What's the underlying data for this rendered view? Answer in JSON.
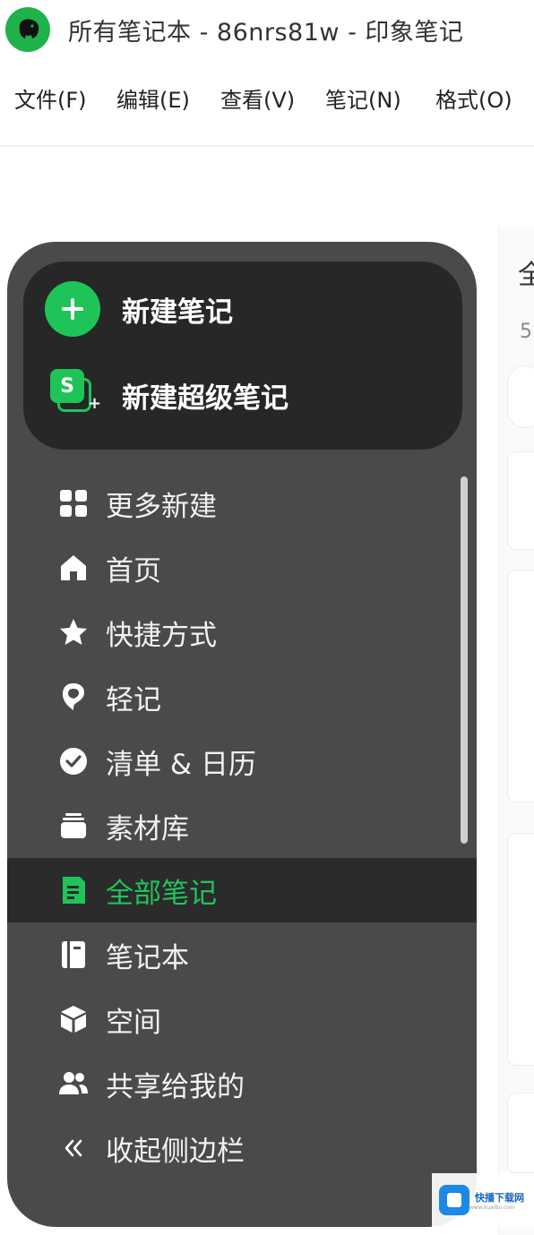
{
  "window": {
    "title": "所有笔记本 - 86nrs81w - 印象笔记",
    "app_icon": "elephant-icon",
    "accent_color": "#1fc459"
  },
  "menu": {
    "items": [
      "文件(F)",
      "编辑(E)",
      "查看(V)",
      "笔记(N)",
      "格式(O)"
    ]
  },
  "sidebar": {
    "create": {
      "new_note": "新建笔记",
      "new_super_note": "新建超级笔记",
      "super_icon_letter": "S"
    },
    "items": [
      {
        "label": "更多新建",
        "icon": "grid-icon",
        "active": false
      },
      {
        "label": "首页",
        "icon": "home-icon",
        "active": false
      },
      {
        "label": "快捷方式",
        "icon": "star-icon",
        "active": false
      },
      {
        "label": "轻记",
        "icon": "quick-note-icon",
        "active": false
      },
      {
        "label": "清单 & 日历",
        "icon": "check-circle-icon",
        "active": false
      },
      {
        "label": "素材库",
        "icon": "library-icon",
        "active": false
      },
      {
        "label": "全部笔记",
        "icon": "note-icon",
        "active": true
      },
      {
        "label": "笔记本",
        "icon": "notebook-icon",
        "active": false
      },
      {
        "label": "空间",
        "icon": "cube-icon",
        "active": false
      },
      {
        "label": "共享给我的",
        "icon": "people-icon",
        "active": false
      },
      {
        "label": "收起侧边栏",
        "icon": "collapse-chevrons-icon",
        "active": false
      }
    ]
  },
  "main": {
    "title_partial": "全",
    "count_partial": "5"
  },
  "watermark": {
    "text": "快播下载网",
    "sub": "www.kuaibo.com"
  }
}
